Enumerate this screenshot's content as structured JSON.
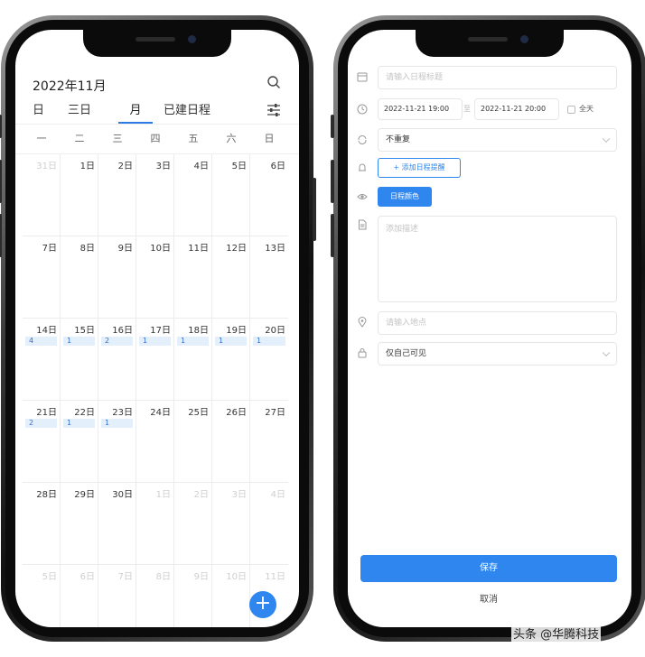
{
  "calendar": {
    "title": "2022年11月",
    "tabs": [
      "日",
      "三日",
      "月",
      "已建日程"
    ],
    "active_tab": "月",
    "weekdays": [
      "一",
      "二",
      "三",
      "四",
      "五",
      "六",
      "日"
    ],
    "weeks": [
      [
        {
          "d": "31日",
          "m": true
        },
        {
          "d": "1日"
        },
        {
          "d": "2日"
        },
        {
          "d": "3日"
        },
        {
          "d": "4日"
        },
        {
          "d": "5日"
        },
        {
          "d": "6日"
        }
      ],
      [
        {
          "d": "7日"
        },
        {
          "d": "8日"
        },
        {
          "d": "9日"
        },
        {
          "d": "10日"
        },
        {
          "d": "11日"
        },
        {
          "d": "12日"
        },
        {
          "d": "13日"
        }
      ],
      [
        {
          "d": "14日",
          "c": "4"
        },
        {
          "d": "15日",
          "c": "1"
        },
        {
          "d": "16日",
          "c": "2"
        },
        {
          "d": "17日",
          "c": "1"
        },
        {
          "d": "18日",
          "c": "1"
        },
        {
          "d": "19日",
          "c": "1"
        },
        {
          "d": "20日",
          "c": "1"
        }
      ],
      [
        {
          "d": "21日",
          "c": "2"
        },
        {
          "d": "22日",
          "c": "1"
        },
        {
          "d": "23日",
          "c": "1"
        },
        {
          "d": "24日"
        },
        {
          "d": "25日"
        },
        {
          "d": "26日"
        },
        {
          "d": "27日"
        }
      ],
      [
        {
          "d": "28日"
        },
        {
          "d": "29日"
        },
        {
          "d": "30日"
        },
        {
          "d": "1日",
          "m": true
        },
        {
          "d": "2日",
          "m": true
        },
        {
          "d": "3日",
          "m": true
        },
        {
          "d": "4日",
          "m": true
        }
      ],
      [
        {
          "d": "5日",
          "m": true
        },
        {
          "d": "6日",
          "m": true
        },
        {
          "d": "7日",
          "m": true
        },
        {
          "d": "8日",
          "m": true
        },
        {
          "d": "9日",
          "m": true
        },
        {
          "d": "10日",
          "m": true
        },
        {
          "d": "11日",
          "m": true
        }
      ]
    ],
    "fab_label": "+"
  },
  "form": {
    "title_placeholder": "请输入日程标题",
    "start_time": "2022-11-21 19:00",
    "to_label": "至",
    "end_time": "2022-11-21 20:00",
    "allday_label": "全天",
    "repeat_value": "不重复",
    "remind_button": "+ 添加日程提醒",
    "color_button": "日程颜色",
    "description_placeholder": "添加描述",
    "location_placeholder": "请输入地点",
    "visibility_value": "仅自己可见",
    "save_button": "保存",
    "cancel_button": "取消"
  },
  "watermark": "头条 @华腾科技",
  "colors": {
    "accent": "#2f86ee",
    "badge_bg": "#e4effc"
  }
}
